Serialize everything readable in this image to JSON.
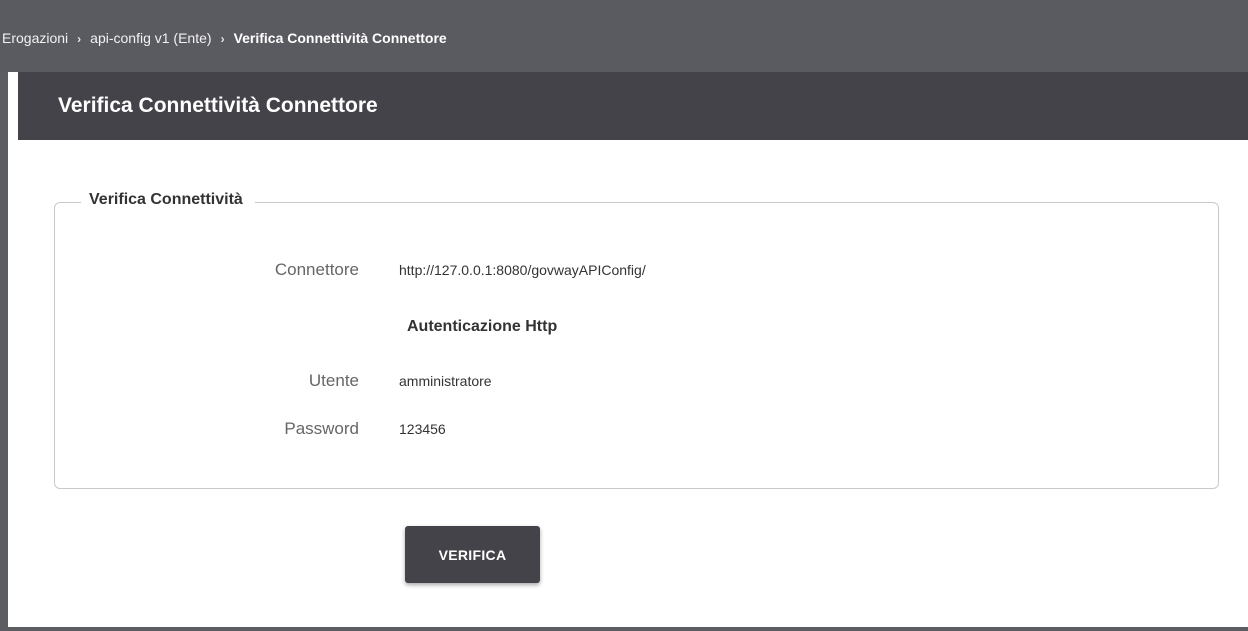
{
  "breadcrumb": {
    "items": [
      "Erogazioni",
      "api-config v1 (Ente)",
      "Verifica Connettività Connettore"
    ]
  },
  "page": {
    "title": "Verifica Connettività Connettore"
  },
  "fieldset": {
    "legend": "Verifica Connettività",
    "connettore_label": "Connettore",
    "connettore_value": "http://127.0.0.1:8080/govwayAPIConfig/",
    "auth_section": "Autenticazione Http",
    "utente_label": "Utente",
    "utente_value": "amministratore",
    "password_label": "Password",
    "password_value": "123456"
  },
  "actions": {
    "verifica_label": "VERIFICA"
  },
  "colors": {
    "header_bg": "#434349",
    "breadcrumb_bg": "#5a5a61",
    "button_bg": "#434349"
  }
}
